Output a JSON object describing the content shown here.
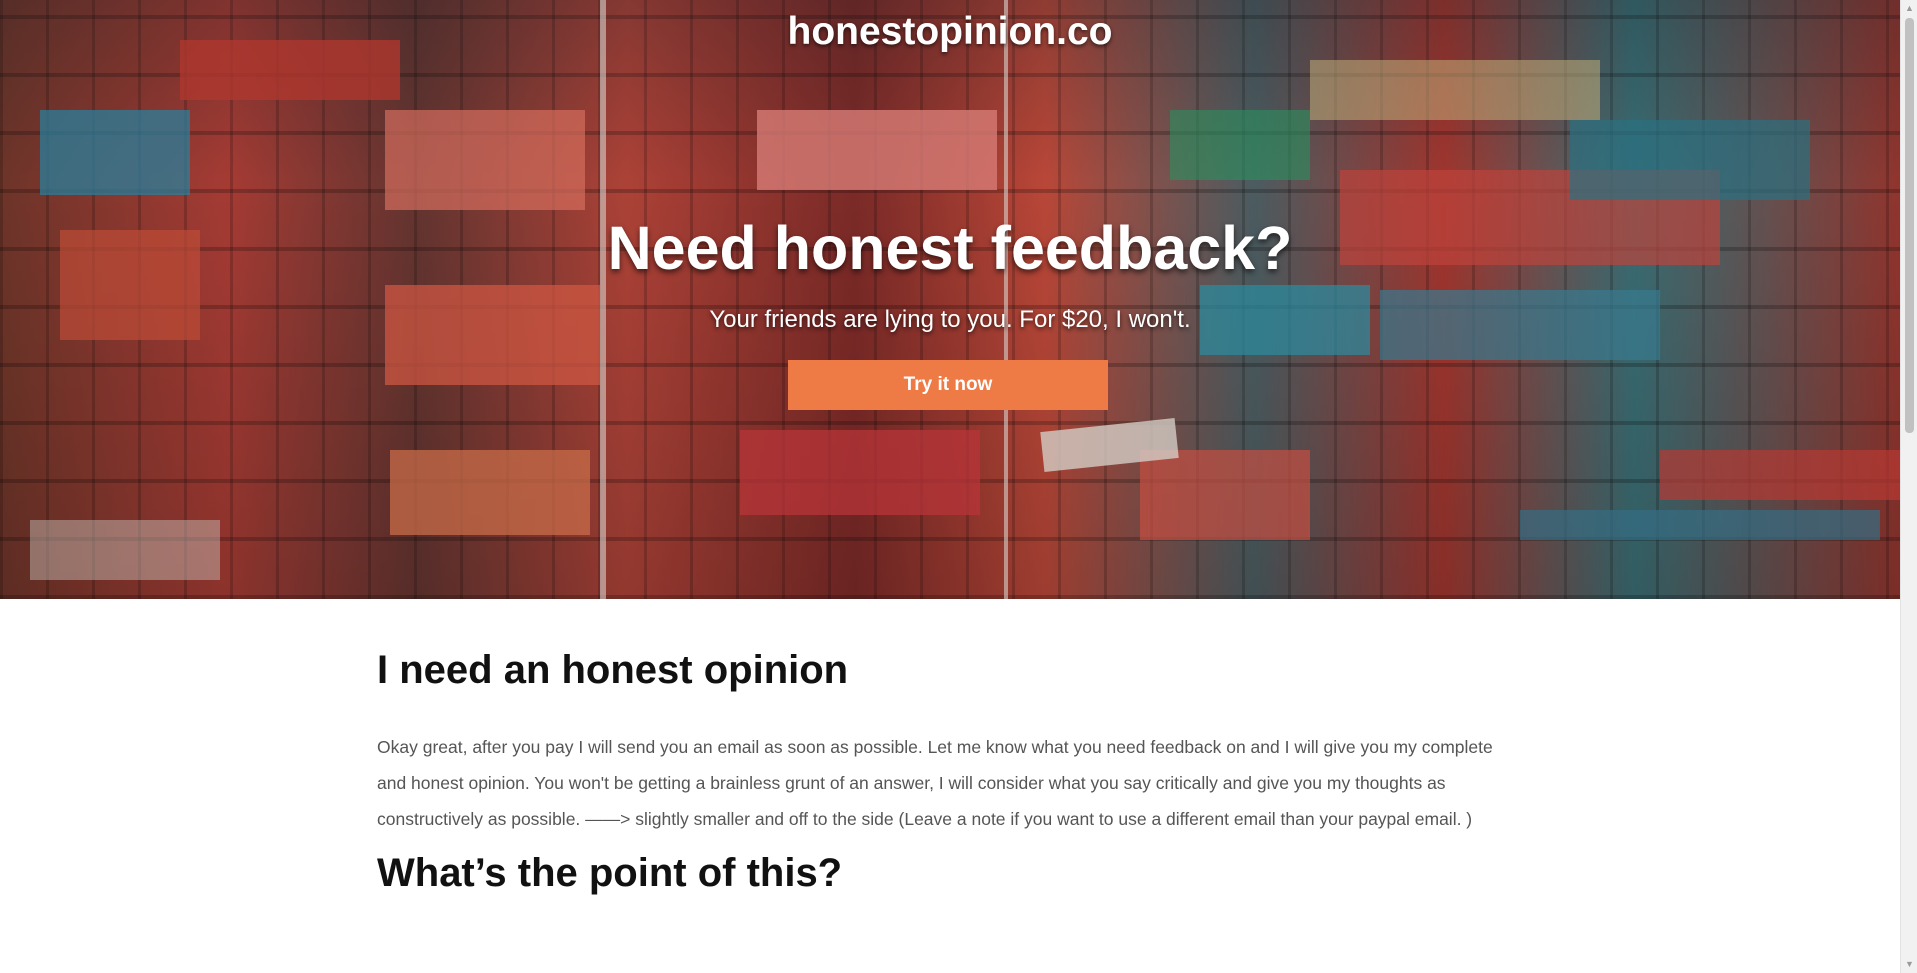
{
  "hero": {
    "site_title": "honestopinion.co",
    "headline": "Need honest feedback?",
    "subheadline": "Your friends are lying to you. For $20, I won't.",
    "cta_label": "Try it now",
    "cta_color": "#ee7a45"
  },
  "main": {
    "section1_heading": "I need an honest opinion",
    "section1_body": "Okay great, after you pay I will send you an email as soon as possible. Let me know what you need feedback on and I will give you my complete and honest opinion. You won't be getting a brainless grunt of an answer, I will consider what you say critically and give you my thoughts as constructively as possible.  ——> slightly smaller and off to the side (Leave a note if you want to use a different email than your paypal email. )",
    "section2_heading": "What’s the point of this?"
  },
  "scrollbar": {
    "up_icon": "scroll-up-arrow-icon",
    "down_icon": "scroll-down-arrow-icon"
  }
}
